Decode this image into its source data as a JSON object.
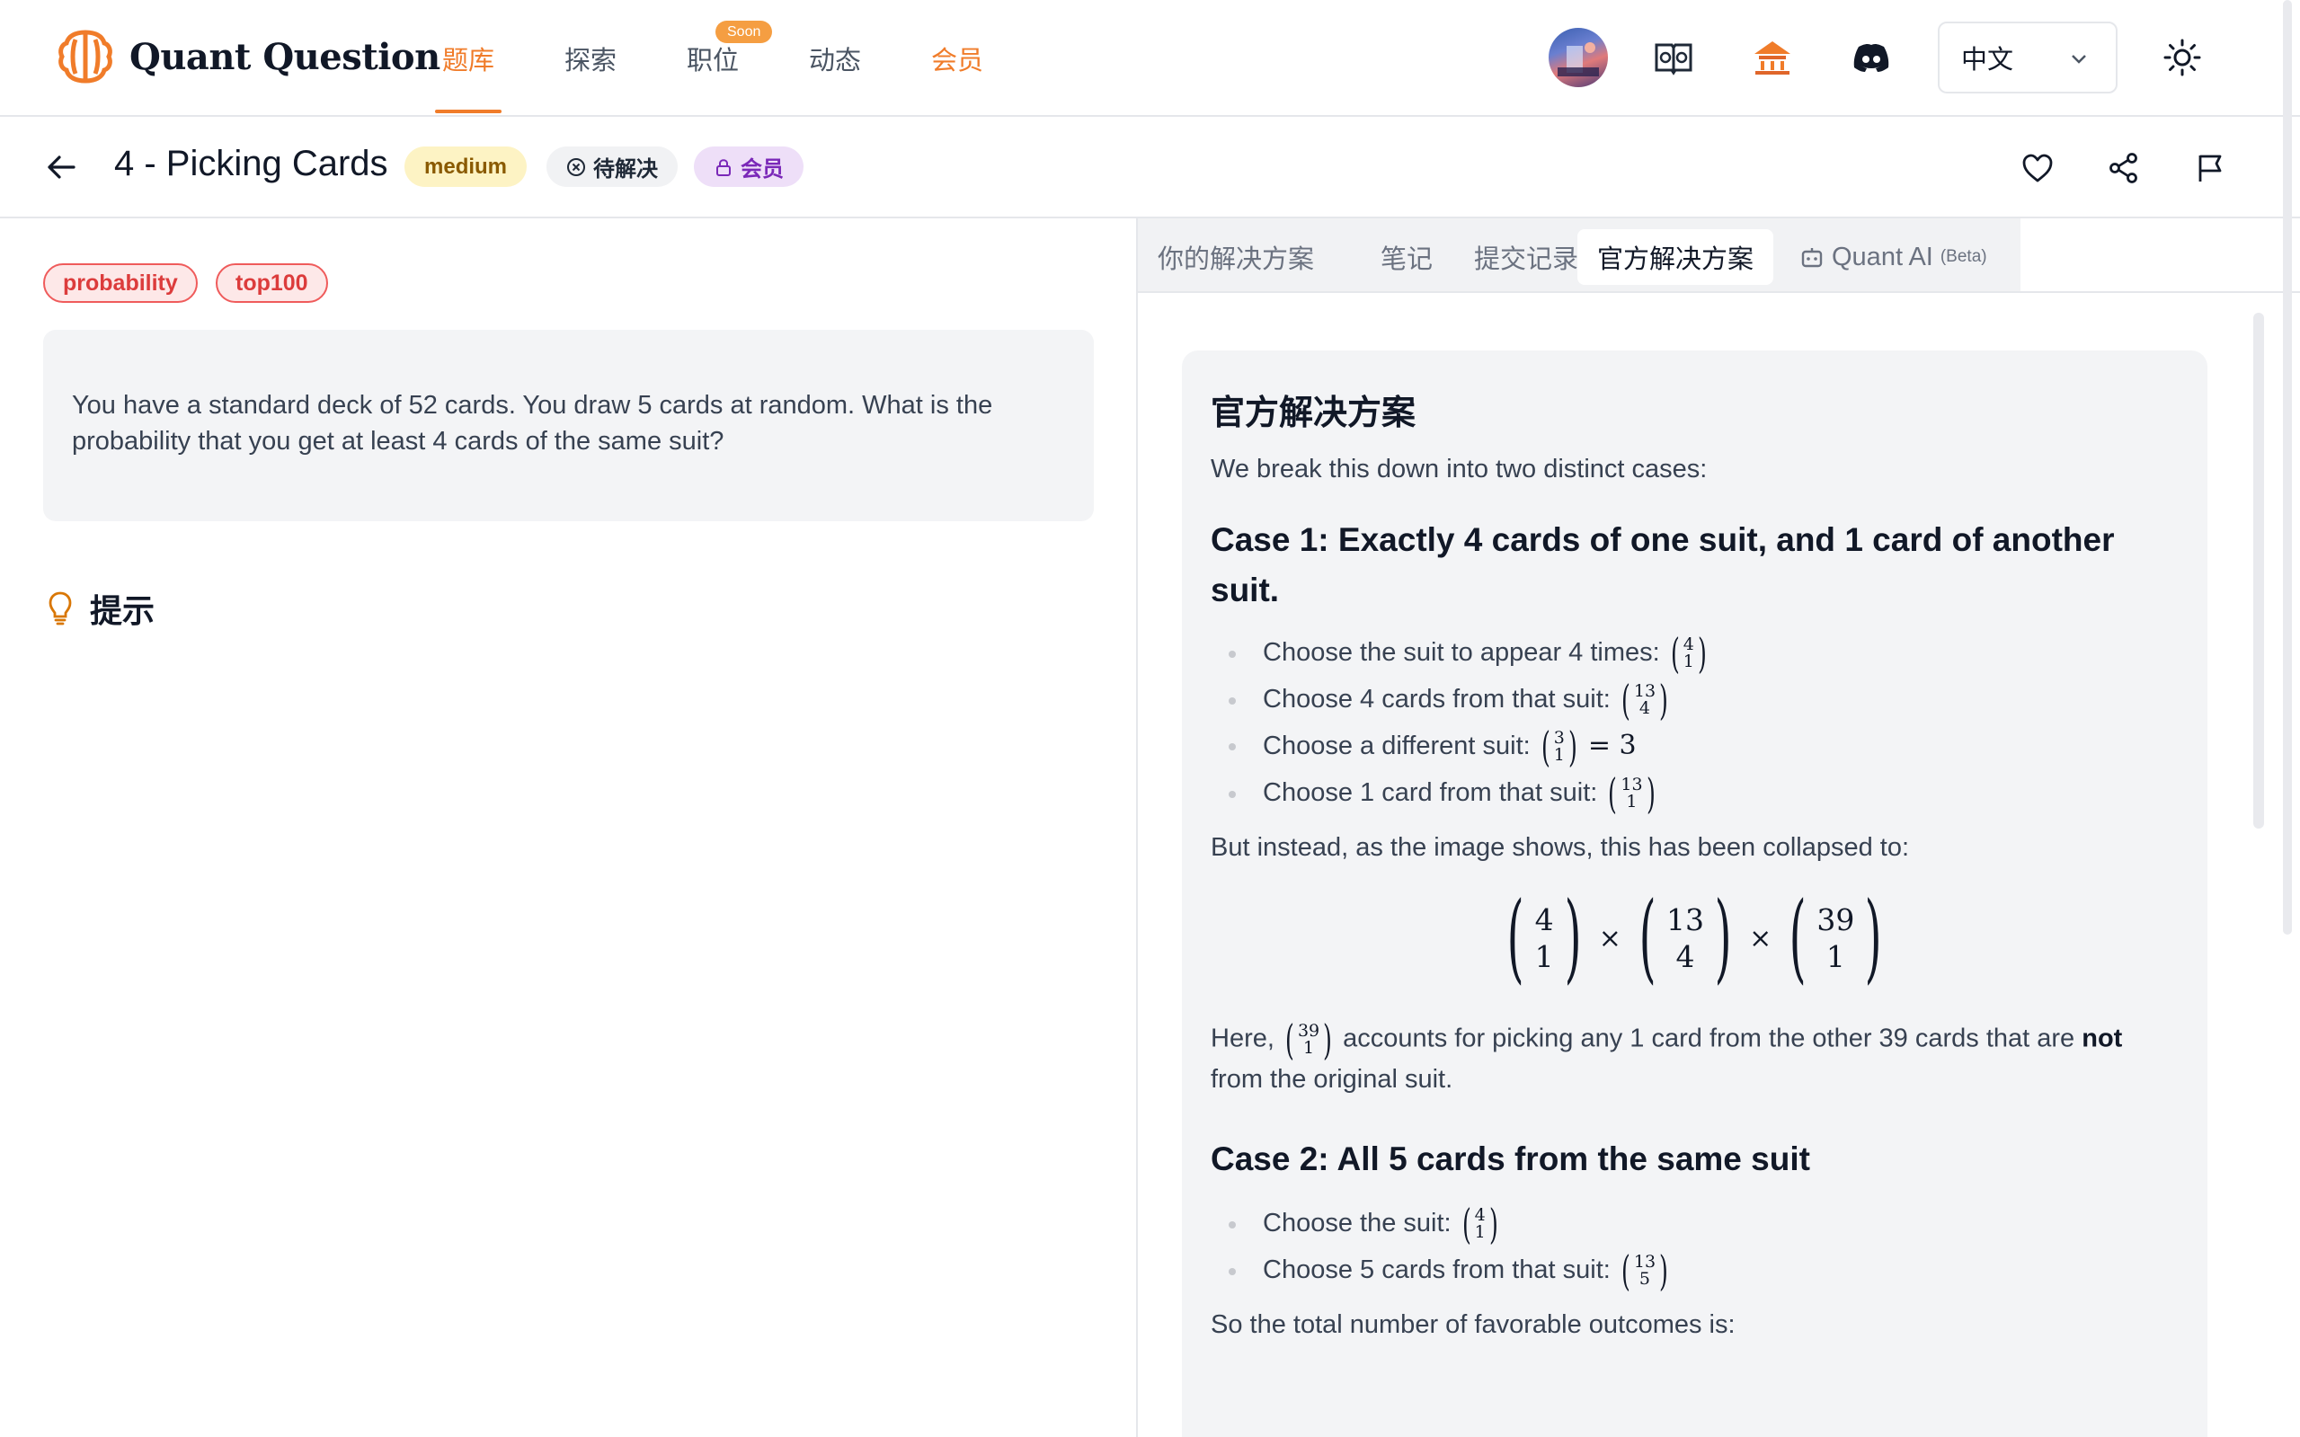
{
  "brand": {
    "name": "Quant Question",
    "accent": "#f07c2a"
  },
  "nav": {
    "items": [
      {
        "label": "题库",
        "state": "active"
      },
      {
        "label": "探索"
      },
      {
        "label": "职位",
        "badge": "Soon"
      },
      {
        "label": "动态"
      },
      {
        "label": "会员",
        "state": "highlight"
      }
    ]
  },
  "header_icons": [
    "avatar",
    "book-icon",
    "temple-icon",
    "discord-icon",
    "sun-icon"
  ],
  "language": {
    "selected": "中文"
  },
  "problem": {
    "title": "4 - Picking Cards",
    "difficulty": "medium",
    "status": "待解决",
    "membership": "会员",
    "actions": [
      "heart-icon",
      "share-icon",
      "flag-icon"
    ]
  },
  "tags": [
    "probability",
    "top100"
  ],
  "question": "You have a standard deck of 52 cards. You draw 5 cards at random. What is the probability that you get at least 4 cards of the same suit?",
  "hint": {
    "label": "提示"
  },
  "tabs": [
    {
      "label": "你的解决方案"
    },
    {
      "label": "笔记"
    },
    {
      "label": "提交记录"
    },
    {
      "label": "官方解决方案",
      "state": "active"
    },
    {
      "label": "Quant AI",
      "suffix": "(Beta)"
    }
  ],
  "solution": {
    "title": "官方解决方案",
    "intro": "We break this down into two distinct cases:",
    "case1": {
      "heading": "Case 1: Exactly 4 cards of one suit, and 1 card of another suit.",
      "bullets": [
        {
          "text": "Choose the suit to appear 4 times:",
          "n": "4",
          "k": "1"
        },
        {
          "text": "Choose 4 cards from that suit:",
          "n": "13",
          "k": "4"
        },
        {
          "text": "Choose a different suit:",
          "n": "3",
          "k": "1",
          "tail": "= 3"
        },
        {
          "text": "Choose 1 card from that suit:",
          "n": "13",
          "k": "1"
        }
      ],
      "collapsed_note": "But instead, as the image shows, this has been collapsed to:",
      "display": [
        {
          "n": "4",
          "k": "1"
        },
        {
          "n": "13",
          "k": "4"
        },
        {
          "n": "39",
          "k": "1"
        }
      ],
      "here_before": "Here,",
      "here_binom": {
        "n": "39",
        "k": "1"
      },
      "here_mid": "accounts for picking any 1 card from the other 39 cards that are",
      "here_bold": "not",
      "here_after": "from the original suit."
    },
    "case2": {
      "heading": "Case 2: All 5 cards from the same suit",
      "bullets": [
        {
          "text": "Choose the suit:",
          "n": "4",
          "k": "1"
        },
        {
          "text": "Choose 5 cards from that suit:",
          "n": "13",
          "k": "5"
        }
      ]
    },
    "cut_text": "So the total number of favorable outcomes is:"
  }
}
